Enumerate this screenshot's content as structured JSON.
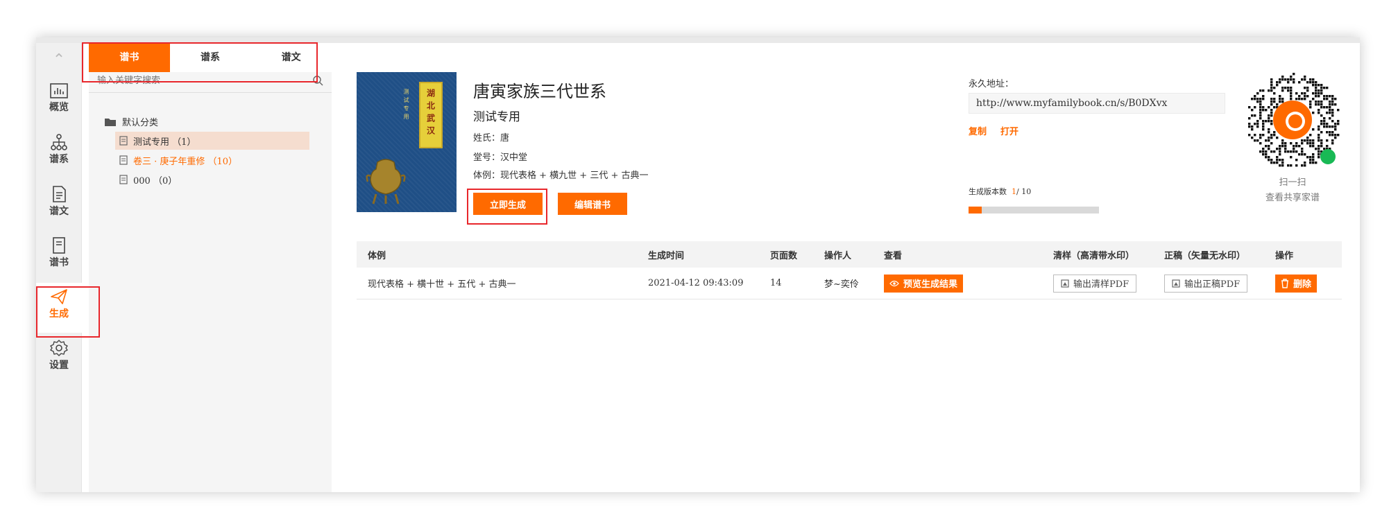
{
  "rail": {
    "items": [
      {
        "label": "概览",
        "icon": "chart-icon"
      },
      {
        "label": "谱系",
        "icon": "tree-icon"
      },
      {
        "label": "谱文",
        "icon": "document-icon"
      },
      {
        "label": "谱书",
        "icon": "book-icon"
      },
      {
        "label": "生成",
        "icon": "send-icon",
        "active": true
      },
      {
        "label": "设置",
        "icon": "gear-icon"
      }
    ]
  },
  "tabs": [
    {
      "label": "谱书",
      "active": true
    },
    {
      "label": "谱系"
    },
    {
      "label": "谱文"
    }
  ],
  "search": {
    "placeholder": "输入关键字搜索"
  },
  "tree": {
    "root": "默认分类",
    "nodes": [
      {
        "label": "测试专用 （1）",
        "selected": true
      },
      {
        "label": "卷三 · 庚子年重修 （10）",
        "highlight": true
      },
      {
        "label": "000 （0）"
      }
    ]
  },
  "book": {
    "cover_title": "湖北武汉",
    "cover_sub": "测试专用",
    "title": "唐寅家族三代世系",
    "subtitle": "测试专用",
    "surname": "姓氏：唐",
    "hall": "堂号：汉中堂",
    "style": "体例：现代表格 + 横九世 + 三代 + 古典一",
    "generate_label": "立即生成",
    "edit_label": "编辑谱书"
  },
  "permalink": {
    "label": "永久地址：",
    "url": "http://www.myfamilybook.cn/s/B0DXvx",
    "copy_label": "复制",
    "open_label": "打开"
  },
  "version": {
    "label": "生成版本数",
    "current": "1",
    "total": "/ 10",
    "fraction": 0.1
  },
  "qr": {
    "caption1": "扫一扫",
    "caption2": "查看共享家谱"
  },
  "table": {
    "headers": [
      "体例",
      "生成时间",
      "页面数",
      "操作人",
      "查看",
      "清样（高清带水印）",
      "正稿（矢量无水印）",
      "操作"
    ],
    "rows": [
      {
        "style": "现代表格 + 横十世 + 五代 + 古典一",
        "time": "2021-04-12 09:43:09",
        "pages": "14",
        "operator": "梦~奕伶",
        "preview_label": "预览生成结果",
        "proof_label": "输出清样PDF",
        "final_label": "输出正稿PDF",
        "delete_label": "删除"
      }
    ]
  },
  "colors": {
    "accent": "#ff6a00",
    "highlight_box": "#e8262b"
  }
}
